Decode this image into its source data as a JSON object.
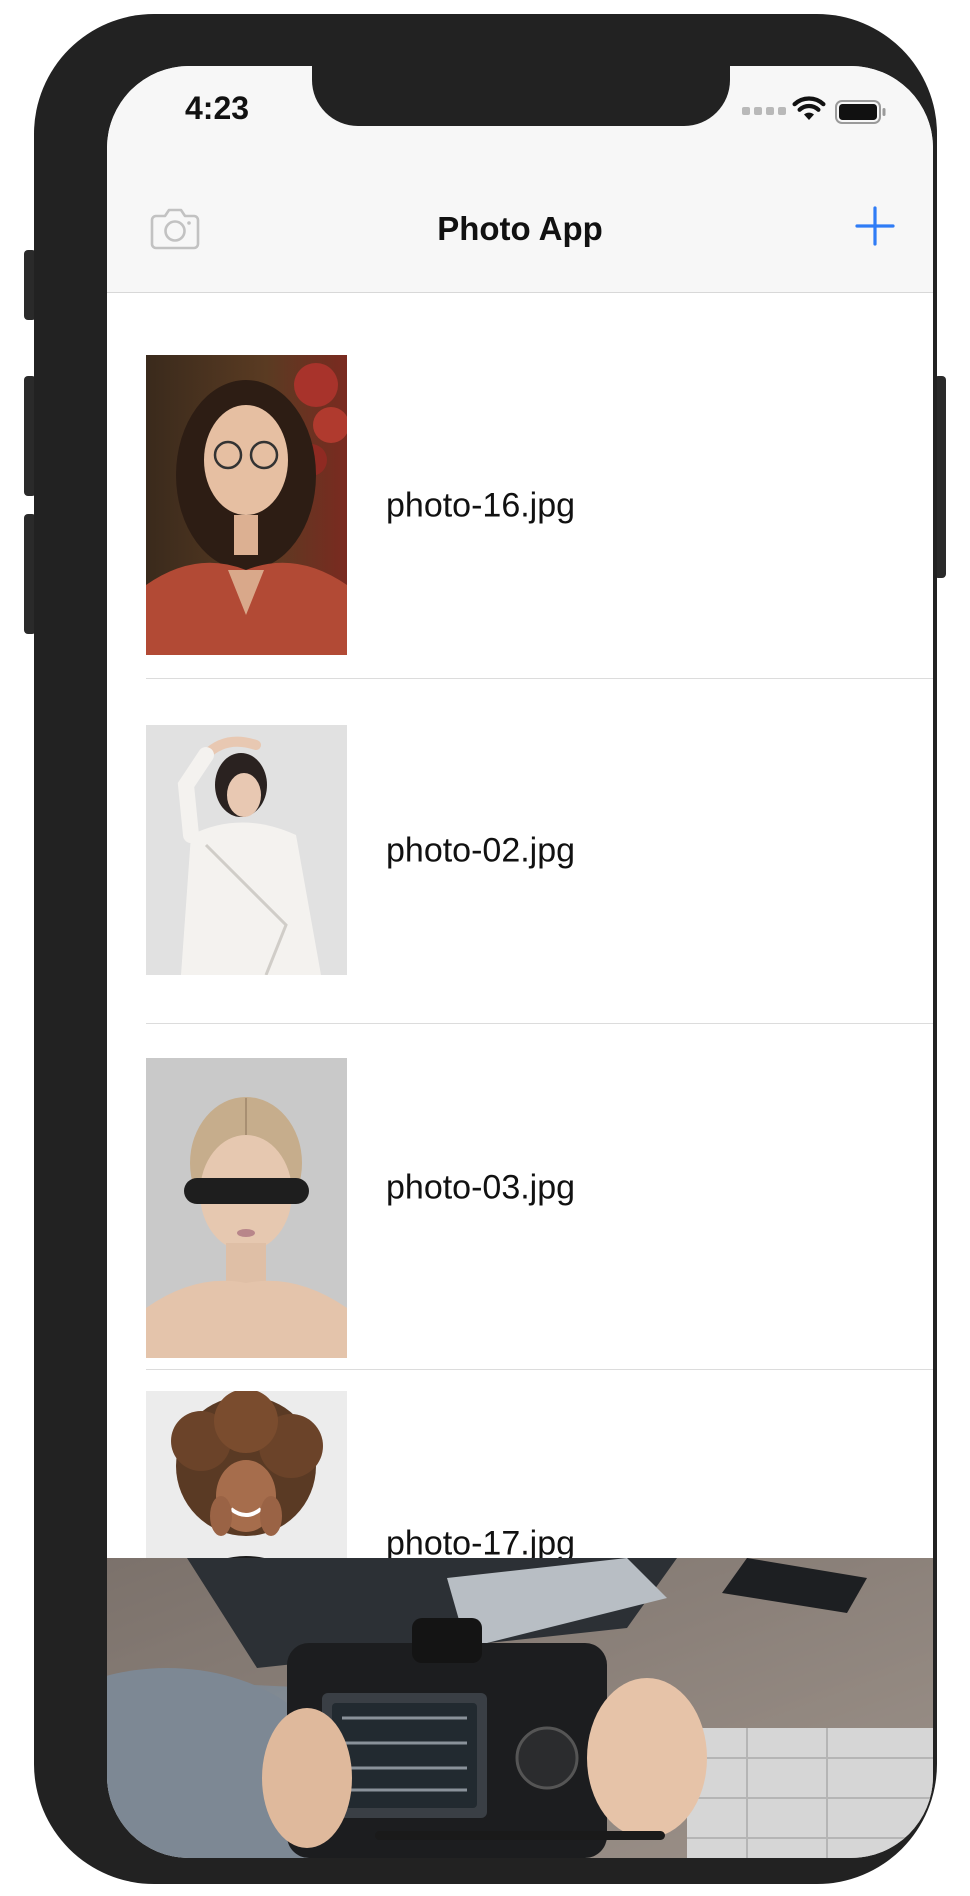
{
  "status_bar": {
    "time": "4:23"
  },
  "navbar": {
    "title": "Photo App",
    "left_icon": "camera-icon",
    "right_icon": "plus-icon",
    "accent_color": "#2f7cf6",
    "camera_icon_color": "#c2c2c2"
  },
  "photos": [
    {
      "name": "photo-16.jpg"
    },
    {
      "name": "photo-02.jpg"
    },
    {
      "name": "photo-03.jpg"
    },
    {
      "name": "photo-17.jpg"
    }
  ]
}
